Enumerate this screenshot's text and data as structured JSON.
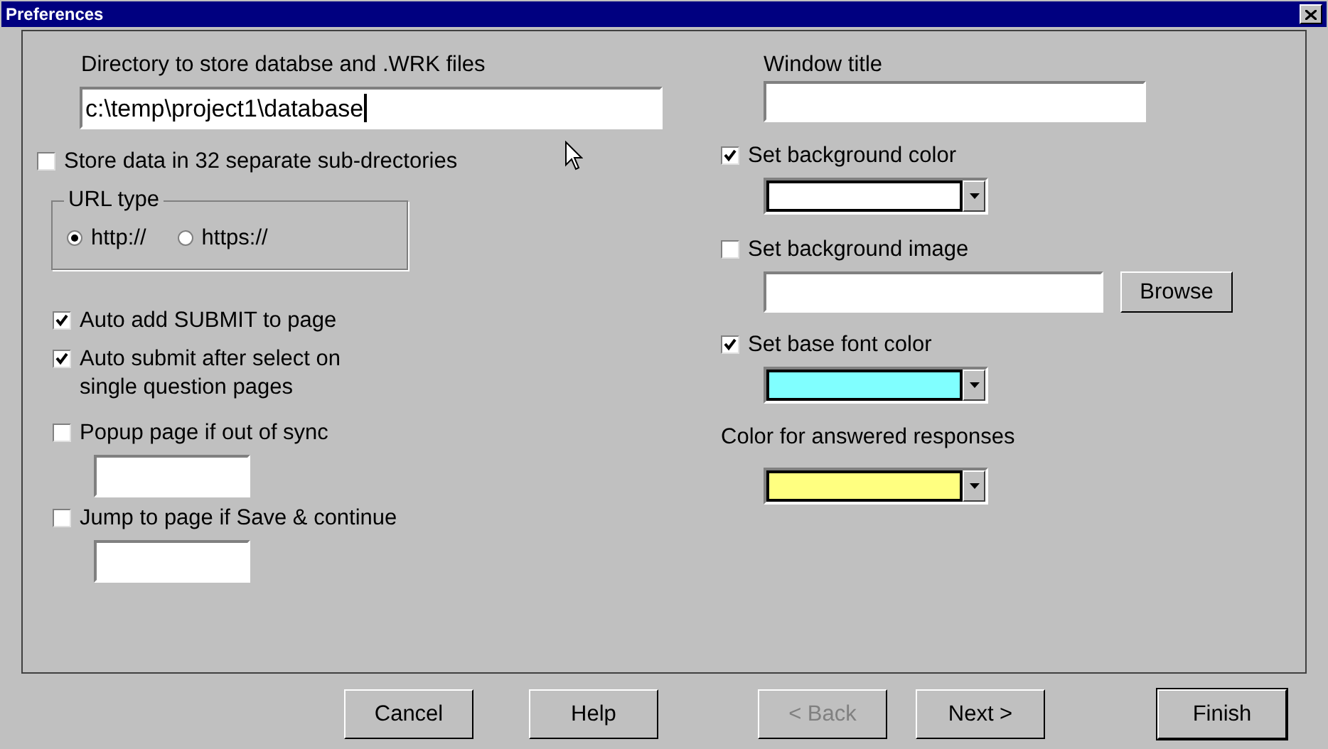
{
  "window": {
    "title": "Preferences"
  },
  "left": {
    "directory_label": "Directory to store databse and .WRK files",
    "directory_value": "c:\\temp\\project1\\database",
    "subdirs": {
      "label": "Store data in 32 separate sub-drectories",
      "checked": false
    },
    "url_type": {
      "legend": "URL type",
      "options": [
        {
          "label": "http://",
          "selected": true
        },
        {
          "label": "https://",
          "selected": false
        }
      ]
    },
    "options": [
      {
        "label": "Auto add SUBMIT to page",
        "checked": true
      },
      {
        "label": "Auto submit after select on single question pages",
        "checked": true
      },
      {
        "label": "Popup page if out of sync",
        "checked": false,
        "field": true
      },
      {
        "label": "Jump to page if Save & continue",
        "checked": false,
        "field": true
      }
    ]
  },
  "right": {
    "window_title_label": "Window title",
    "background_color": {
      "label": "Set background color",
      "checked": true,
      "color": "#ffffff"
    },
    "background_image": {
      "label": "Set background image",
      "checked": false,
      "button": "Browse"
    },
    "base_font_color": {
      "label": "Set base font color",
      "checked": true,
      "color": "#80ffff"
    },
    "answered": {
      "label": "Color for answered responses",
      "color": "#ffff80"
    }
  },
  "buttons": [
    {
      "label": "Cancel",
      "disabled": false,
      "default": false
    },
    {
      "label": "Help",
      "disabled": false,
      "default": false
    },
    {
      "label": "< Back",
      "disabled": true,
      "default": false
    },
    {
      "label": "Next >",
      "disabled": false,
      "default": false
    },
    {
      "label": "Finish",
      "disabled": false,
      "default": true
    }
  ]
}
